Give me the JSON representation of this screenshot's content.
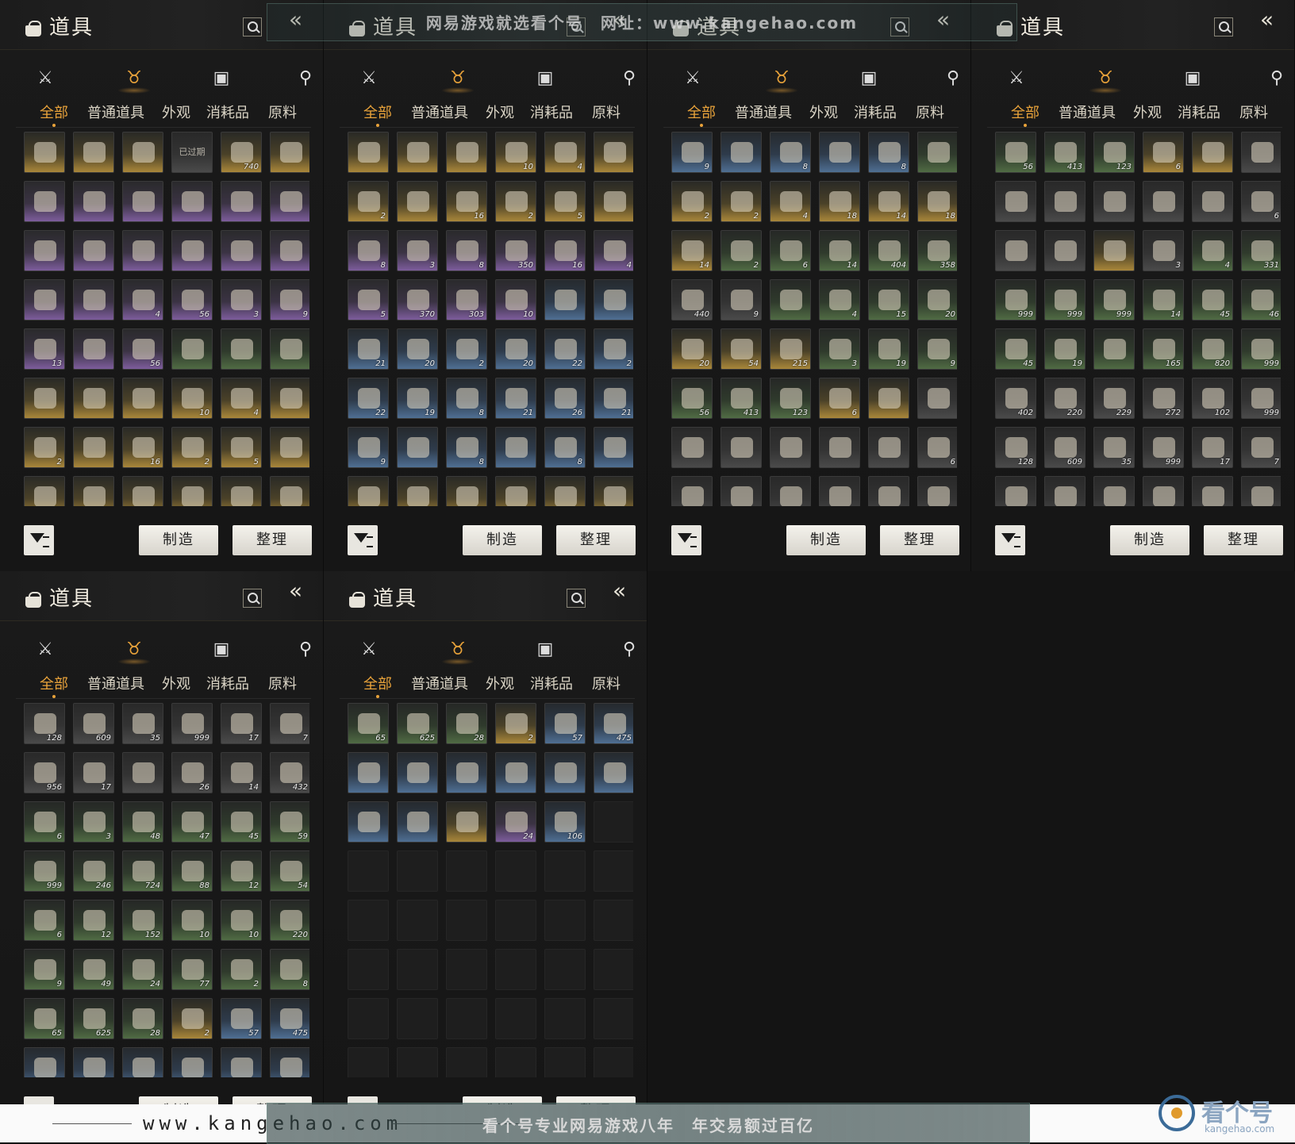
{
  "header": {
    "title": "道具"
  },
  "tabs": [
    "全部",
    "普通道具",
    "外观",
    "消耗品",
    "原料"
  ],
  "buttons": {
    "craft": "制造",
    "sort": "整理"
  },
  "watermark": {
    "top": "网易游戏就选看个号　网址：www.kangehao.com",
    "url": "www.kangehao.com",
    "slogan": "看个号专业网易游戏八年　年交易额过百亿",
    "logo": "看个号",
    "logo_sub": "kangehao.com"
  },
  "panels": [
    {
      "cells": [
        [
          "gold",
          ""
        ],
        [
          "gold",
          ""
        ],
        [
          "gold",
          ""
        ],
        [
          "gray",
          "",
          "已过期"
        ],
        [
          "gold",
          "740"
        ],
        [
          "gold",
          ""
        ],
        [
          "purple",
          ""
        ],
        [
          "purple",
          ""
        ],
        [
          "purple",
          ""
        ],
        [
          "purple",
          ""
        ],
        [
          "purple",
          ""
        ],
        [
          "purple",
          ""
        ],
        [
          "purple",
          ""
        ],
        [
          "purple",
          ""
        ],
        [
          "purple",
          ""
        ],
        [
          "purple",
          ""
        ],
        [
          "purple",
          ""
        ],
        [
          "purple",
          ""
        ],
        [
          "purple",
          ""
        ],
        [
          "purple",
          ""
        ],
        [
          "purple",
          "4"
        ],
        [
          "purple",
          "56"
        ],
        [
          "purple",
          "3"
        ],
        [
          "purple",
          "9"
        ],
        [
          "purple",
          "13"
        ],
        [
          "purple",
          ""
        ],
        [
          "purple",
          "56"
        ],
        [
          "green",
          ""
        ],
        [
          "green",
          ""
        ],
        [
          "green",
          ""
        ],
        [
          "gold",
          ""
        ],
        [
          "gold",
          ""
        ],
        [
          "gold",
          ""
        ],
        [
          "gold",
          "10"
        ],
        [
          "gold",
          "4"
        ],
        [
          "gold",
          ""
        ],
        [
          "gold",
          "2"
        ],
        [
          "gold",
          ""
        ],
        [
          "gold",
          "16"
        ],
        [
          "gold",
          "2"
        ],
        [
          "gold",
          "5"
        ],
        [
          "gold",
          ""
        ],
        [
          "gold",
          ""
        ],
        [
          "gold",
          ""
        ],
        [
          "gold",
          ""
        ],
        [
          "gold",
          ""
        ],
        [
          "gold",
          ""
        ],
        [
          "gold",
          ""
        ]
      ]
    },
    {
      "cells": [
        [
          "gold",
          ""
        ],
        [
          "gold",
          ""
        ],
        [
          "gold",
          ""
        ],
        [
          "gold",
          "10"
        ],
        [
          "gold",
          "4"
        ],
        [
          "gold",
          ""
        ],
        [
          "gold",
          "2"
        ],
        [
          "gold",
          ""
        ],
        [
          "gold",
          "16"
        ],
        [
          "gold",
          "2"
        ],
        [
          "gold",
          "5"
        ],
        [
          "gold",
          ""
        ],
        [
          "purple",
          "8"
        ],
        [
          "purple",
          "3"
        ],
        [
          "purple",
          "8"
        ],
        [
          "purple",
          "350"
        ],
        [
          "purple",
          "16"
        ],
        [
          "purple",
          "4"
        ],
        [
          "purple",
          "5"
        ],
        [
          "purple",
          "370"
        ],
        [
          "purple",
          "303"
        ],
        [
          "purple",
          "10"
        ],
        [
          "blue",
          ""
        ],
        [
          "blue",
          ""
        ],
        [
          "blue",
          "21"
        ],
        [
          "blue",
          "20"
        ],
        [
          "blue",
          "2"
        ],
        [
          "blue",
          "20"
        ],
        [
          "blue",
          "22"
        ],
        [
          "blue",
          "2"
        ],
        [
          "blue",
          "22"
        ],
        [
          "blue",
          "19"
        ],
        [
          "blue",
          "8"
        ],
        [
          "blue",
          "21"
        ],
        [
          "blue",
          "26"
        ],
        [
          "blue",
          "21"
        ],
        [
          "blue",
          "9"
        ],
        [
          "blue",
          ""
        ],
        [
          "blue",
          "8"
        ],
        [
          "blue",
          ""
        ],
        [
          "blue",
          "8"
        ],
        [
          "blue",
          ""
        ],
        [
          "gold",
          "2"
        ],
        [
          "gold",
          "2"
        ],
        [
          "gold",
          "4"
        ],
        [
          "gold",
          "18"
        ],
        [
          "gold",
          "14"
        ],
        [
          "gold",
          "18"
        ]
      ]
    },
    {
      "cells": [
        [
          "blue",
          "9"
        ],
        [
          "blue",
          ""
        ],
        [
          "blue",
          "8"
        ],
        [
          "blue",
          ""
        ],
        [
          "blue",
          "8"
        ],
        [
          "green",
          ""
        ],
        [
          "gold",
          "2"
        ],
        [
          "gold",
          "2"
        ],
        [
          "gold",
          "4"
        ],
        [
          "gold",
          "18"
        ],
        [
          "gold",
          "14"
        ],
        [
          "gold",
          "18"
        ],
        [
          "gold",
          "14"
        ],
        [
          "green",
          "2"
        ],
        [
          "green",
          "6"
        ],
        [
          "green",
          "14"
        ],
        [
          "green",
          "404"
        ],
        [
          "green",
          "358"
        ],
        [
          "gray",
          "440"
        ],
        [
          "gray",
          "9"
        ],
        [
          "green",
          ""
        ],
        [
          "green",
          "4"
        ],
        [
          "green",
          "15"
        ],
        [
          "green",
          "20"
        ],
        [
          "gold",
          "20"
        ],
        [
          "gold",
          "54"
        ],
        [
          "gold",
          "215"
        ],
        [
          "green",
          "3"
        ],
        [
          "green",
          "19"
        ],
        [
          "green",
          "9"
        ],
        [
          "green",
          "56"
        ],
        [
          "green",
          "413"
        ],
        [
          "green",
          "123"
        ],
        [
          "gold",
          "6"
        ],
        [
          "gold",
          ""
        ],
        [
          "gray",
          ""
        ],
        [
          "gray",
          ""
        ],
        [
          "gray",
          ""
        ],
        [
          "gray",
          ""
        ],
        [
          "gray",
          ""
        ],
        [
          "gray",
          ""
        ],
        [
          "gray",
          "6"
        ],
        [
          "gray",
          ""
        ],
        [
          "gray",
          ""
        ],
        [
          "gray",
          ""
        ],
        [
          "gray",
          ""
        ],
        [
          "gray",
          ""
        ],
        [
          "gray",
          ""
        ]
      ]
    },
    {
      "cells": [
        [
          "green",
          "56"
        ],
        [
          "green",
          "413"
        ],
        [
          "green",
          "123"
        ],
        [
          "gold",
          "6"
        ],
        [
          "gold",
          ""
        ],
        [
          "gray",
          ""
        ],
        [
          "gray",
          ""
        ],
        [
          "gray",
          ""
        ],
        [
          "gray",
          ""
        ],
        [
          "gray",
          ""
        ],
        [
          "gray",
          ""
        ],
        [
          "gray",
          "6"
        ],
        [
          "gray",
          ""
        ],
        [
          "gray",
          ""
        ],
        [
          "gold",
          ""
        ],
        [
          "gray",
          "3"
        ],
        [
          "green",
          "4"
        ],
        [
          "green",
          "331"
        ],
        [
          "green",
          "999"
        ],
        [
          "green",
          "999"
        ],
        [
          "green",
          "999"
        ],
        [
          "green",
          "14"
        ],
        [
          "green",
          "45"
        ],
        [
          "green",
          "46"
        ],
        [
          "green",
          "45"
        ],
        [
          "green",
          "19"
        ],
        [
          "green",
          ""
        ],
        [
          "green",
          "165"
        ],
        [
          "green",
          "820"
        ],
        [
          "green",
          "999"
        ],
        [
          "gray",
          "402"
        ],
        [
          "gray",
          "220"
        ],
        [
          "gray",
          "229"
        ],
        [
          "gray",
          "272"
        ],
        [
          "gray",
          "102"
        ],
        [
          "gray",
          "999"
        ],
        [
          "gray",
          "128"
        ],
        [
          "gray",
          "609"
        ],
        [
          "gray",
          "35"
        ],
        [
          "gray",
          "999"
        ],
        [
          "gray",
          "17"
        ],
        [
          "gray",
          "7"
        ],
        [
          "gray",
          "956"
        ],
        [
          "gray",
          "17"
        ],
        [
          "gray",
          ""
        ],
        [
          "gray",
          "26"
        ],
        [
          "gray",
          "14"
        ],
        [
          "gray",
          "432"
        ]
      ]
    },
    {
      "cells": [
        [
          "gray",
          "128"
        ],
        [
          "gray",
          "609"
        ],
        [
          "gray",
          "35"
        ],
        [
          "gray",
          "999"
        ],
        [
          "gray",
          "17"
        ],
        [
          "gray",
          "7"
        ],
        [
          "gray",
          "956"
        ],
        [
          "gray",
          "17"
        ],
        [
          "gray",
          ""
        ],
        [
          "gray",
          "26"
        ],
        [
          "gray",
          "14"
        ],
        [
          "gray",
          "432"
        ],
        [
          "green",
          "6"
        ],
        [
          "green",
          "3"
        ],
        [
          "green",
          "48"
        ],
        [
          "green",
          "47"
        ],
        [
          "green",
          "45"
        ],
        [
          "green",
          "59"
        ],
        [
          "green",
          "999"
        ],
        [
          "green",
          "246"
        ],
        [
          "green",
          "724"
        ],
        [
          "green",
          "88"
        ],
        [
          "green",
          "12"
        ],
        [
          "green",
          "54"
        ],
        [
          "green",
          "6"
        ],
        [
          "green",
          "12"
        ],
        [
          "green",
          "152"
        ],
        [
          "green",
          "10"
        ],
        [
          "green",
          "10"
        ],
        [
          "green",
          "220"
        ],
        [
          "green",
          "9"
        ],
        [
          "green",
          "49"
        ],
        [
          "green",
          "24"
        ],
        [
          "green",
          "77"
        ],
        [
          "green",
          "2"
        ],
        [
          "green",
          "8"
        ],
        [
          "green",
          "65"
        ],
        [
          "green",
          "625"
        ],
        [
          "green",
          "28"
        ],
        [
          "gold",
          "2"
        ],
        [
          "blue",
          "57"
        ],
        [
          "blue",
          "475"
        ],
        [
          "blue",
          ""
        ],
        [
          "blue",
          ""
        ],
        [
          "blue",
          ""
        ],
        [
          "blue",
          ""
        ],
        [
          "blue",
          ""
        ],
        [
          "blue",
          ""
        ]
      ]
    },
    {
      "cells": [
        [
          "green",
          "65"
        ],
        [
          "green",
          "625"
        ],
        [
          "green",
          "28"
        ],
        [
          "gold",
          "2"
        ],
        [
          "blue",
          "57"
        ],
        [
          "blue",
          "475"
        ],
        [
          "blue",
          ""
        ],
        [
          "blue",
          ""
        ],
        [
          "blue",
          ""
        ],
        [
          "blue",
          ""
        ],
        [
          "blue",
          ""
        ],
        [
          "blue",
          ""
        ],
        [
          "blue",
          ""
        ],
        [
          "blue",
          ""
        ],
        [
          "gold",
          ""
        ],
        [
          "purple",
          "24"
        ],
        [
          "blue",
          "106"
        ],
        [
          "empty",
          ""
        ],
        [
          "empty",
          ""
        ],
        [
          "empty",
          ""
        ],
        [
          "empty",
          ""
        ],
        [
          "empty",
          ""
        ],
        [
          "empty",
          ""
        ],
        [
          "empty",
          ""
        ],
        [
          "empty",
          ""
        ],
        [
          "empty",
          ""
        ],
        [
          "empty",
          ""
        ],
        [
          "empty",
          ""
        ],
        [
          "empty",
          ""
        ],
        [
          "empty",
          ""
        ],
        [
          "empty",
          ""
        ],
        [
          "empty",
          ""
        ],
        [
          "empty",
          ""
        ],
        [
          "empty",
          ""
        ],
        [
          "empty",
          ""
        ],
        [
          "empty",
          ""
        ],
        [
          "empty",
          ""
        ],
        [
          "empty",
          ""
        ],
        [
          "empty",
          ""
        ],
        [
          "empty",
          ""
        ],
        [
          "empty",
          ""
        ],
        [
          "empty",
          ""
        ],
        [
          "empty",
          ""
        ],
        [
          "empty",
          ""
        ],
        [
          "empty",
          ""
        ],
        [
          "empty",
          ""
        ],
        [
          "empty",
          ""
        ],
        [
          "empty",
          ""
        ]
      ]
    }
  ]
}
